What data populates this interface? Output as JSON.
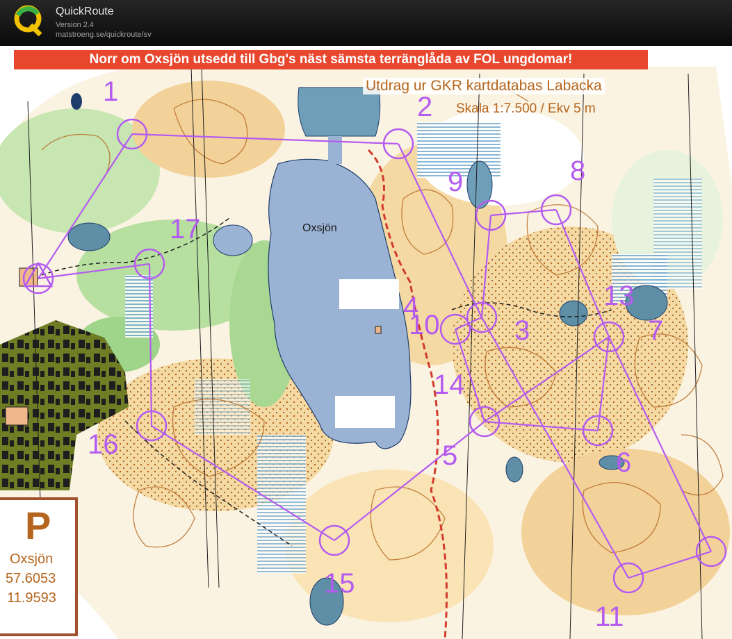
{
  "app": {
    "name": "QuickRoute",
    "version": "Version 2.4",
    "url": "matstroeng.se/quickroute/sv"
  },
  "map": {
    "headline": "Norr om Oxsjön utsedd till Gbg's näst sämsta terränglåda av FOL ungdomar!",
    "source": "Utdrag ur GKR kartdatabas Labacka",
    "scale": "Skala 1:7.500 / Ekv 5 m",
    "lake_name": "Oxsjön",
    "parking": {
      "symbol": "P",
      "name": "Oxsjön",
      "lat": "57.6053",
      "lon": "11.9593"
    },
    "control_numbers": {
      "c1": "1",
      "c2": "2",
      "c3": "3",
      "c4": "4",
      "c5": "5",
      "c6": "6",
      "c7": "7",
      "c8": "8",
      "c9": "9",
      "c10": "10",
      "c11": "11",
      "c13": "13",
      "c14": "14",
      "c15": "15",
      "c16": "16",
      "c17": "17"
    }
  },
  "colors": {
    "banner": "#e8472e",
    "course": "#b45bf0",
    "water": "#9ab3d4",
    "forest_green": "#9ccf86",
    "rough_yellow": "#f5d9a3",
    "contour_brown": "#b5651d",
    "settlement": "#5b6b1e"
  }
}
